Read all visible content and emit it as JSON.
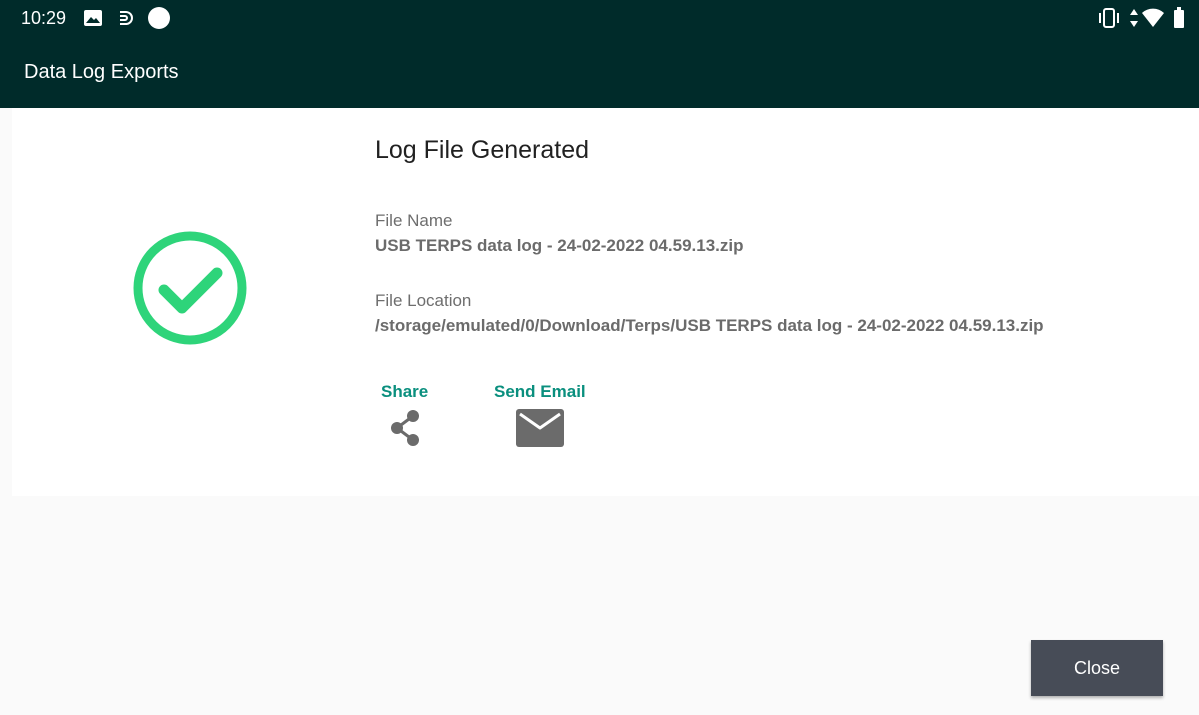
{
  "status_bar": {
    "time": "10:29",
    "left_icons": [
      "image-icon",
      "cast-icon",
      "circle-icon"
    ],
    "right_icons": [
      "vibrate-icon",
      "data-arrows-icon",
      "wifi-icon",
      "battery-icon"
    ]
  },
  "app_bar": {
    "title": "Data Log Exports"
  },
  "result": {
    "title": "Log File Generated",
    "status_icon": "check-circle-icon",
    "status_color": "#2ed47a",
    "file_name_label": "File Name",
    "file_name": "USB TERPS data log - 24-02-2022 04.59.13.zip",
    "file_location_label": "File Location",
    "file_location": "/storage/emulated/0/Download/Terps/USB TERPS data log - 24-02-2022 04.59.13.zip"
  },
  "actions": {
    "share_label": "Share",
    "share_icon": "share-icon",
    "email_label": "Send Email",
    "email_icon": "mail-icon",
    "accent_color": "#0a8f7e"
  },
  "footer": {
    "close_label": "Close"
  }
}
